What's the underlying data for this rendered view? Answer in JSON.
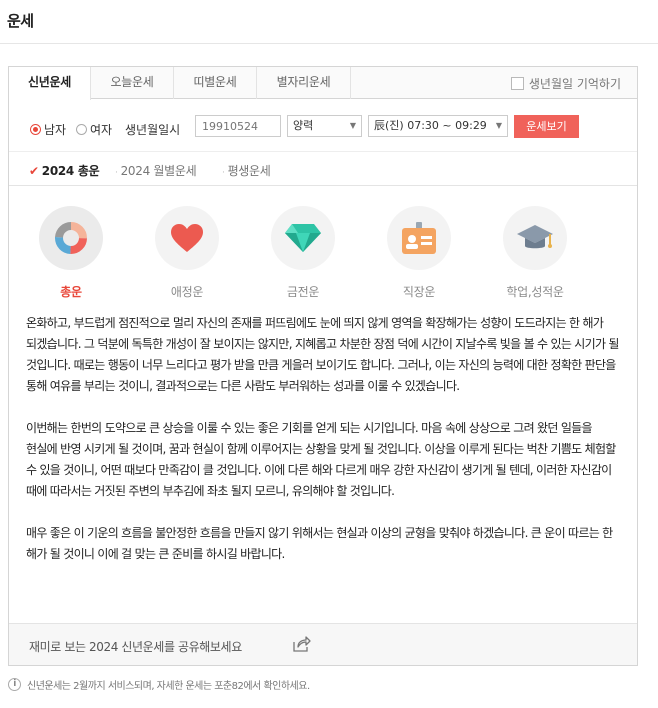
{
  "header": {
    "title": "운세"
  },
  "tabs": [
    {
      "label": "신년운세",
      "active": true
    },
    {
      "label": "오늘운세",
      "active": false
    },
    {
      "label": "띠별운세",
      "active": false
    },
    {
      "label": "별자리운세",
      "active": false
    }
  ],
  "remember_birth": {
    "label": "생년월일 기억하기",
    "checked": false
  },
  "form": {
    "gender_male": "남자",
    "gender_female": "여자",
    "gender_selected": "남자",
    "birth_label": "생년월일시",
    "birth_placeholder": "19910524",
    "calendar_select": "양력",
    "time_select": "辰(진) 07:30 ~ 09:29",
    "submit_label": "운세보기"
  },
  "subtabs": [
    {
      "label": "2024 총운",
      "active": true
    },
    {
      "label": "2024 월별운세",
      "active": false
    },
    {
      "label": "평생운세",
      "active": false
    }
  ],
  "categories": [
    {
      "label": "총운",
      "icon": "donut-chart-icon",
      "active": true
    },
    {
      "label": "애정운",
      "icon": "heart-icon",
      "active": false
    },
    {
      "label": "금전운",
      "icon": "diamond-icon",
      "active": false
    },
    {
      "label": "직장운",
      "icon": "id-card-icon",
      "active": false
    },
    {
      "label": "학업,성적운",
      "icon": "graduation-cap-icon",
      "active": false
    }
  ],
  "description": [
    "온화하고, 부드럽게 점진적으로 멀리 자신의 존재를 퍼뜨림에도 눈에 띄지 않게 영역을 확장해가는 성향이 도드라지는 한 해가 되겠습니다. 그 덕분에 독특한 개성이 잘 보이지는 않지만, 지혜롭고 차분한 장점 덕에 시간이 지날수록 빛을 볼 수 있는 시기가 될 것입니다. 때로는 행동이 너무 느리다고 평가 받을 만큼 게을러 보이기도 합니다. 그러나, 이는 자신의 능력에 대한 정확한 판단을 통해 여유를 부리는 것이니, 결과적으로는 다른 사람도 부러워하는 성과를 이룰 수 있겠습니다.",
    "이번해는 한번의 도약으로 큰 상승을 이룰 수 있는 좋은 기회를 얻게 되는 시기입니다. 마음 속에 상상으로 그려 왔던 일들을 현실에 반영 시키게 될 것이며, 꿈과 현실이 함께 이루어지는 상황을 맞게 될 것입니다. 이상을 이루게 된다는 벅찬 기쁨도 체험할 수 있을 것이니, 어떤 때보다 만족감이 클 것입니다. 이에 다른 해와 다르게 매우 강한 자신감이 생기게 될 텐데, 이러한 자신감이 때에 따라서는 거짓된 주변의 부추김에 좌초 될지 모르니, 유의해야 할 것입니다.",
    "매우 좋은 이 기운의 흐름을 불안정한 흐름을 만들지 않기 위해서는 현실과 이상의 균형을 맞춰야 하겠습니다. 큰 운이 따르는 한 해가 될 것이니 이에 걸 맞는 큰 준비를 하시길 바랍니다."
  ],
  "share": {
    "text": "재미로 보는 2024 신년운세를 공유해보세요"
  },
  "footnote": "신년운세는 2월까지 서비스되며, 자세한 운세는 포춘82에서 확인하세요.",
  "colors": {
    "accent": "#e8473a",
    "button": "#f0625a"
  }
}
